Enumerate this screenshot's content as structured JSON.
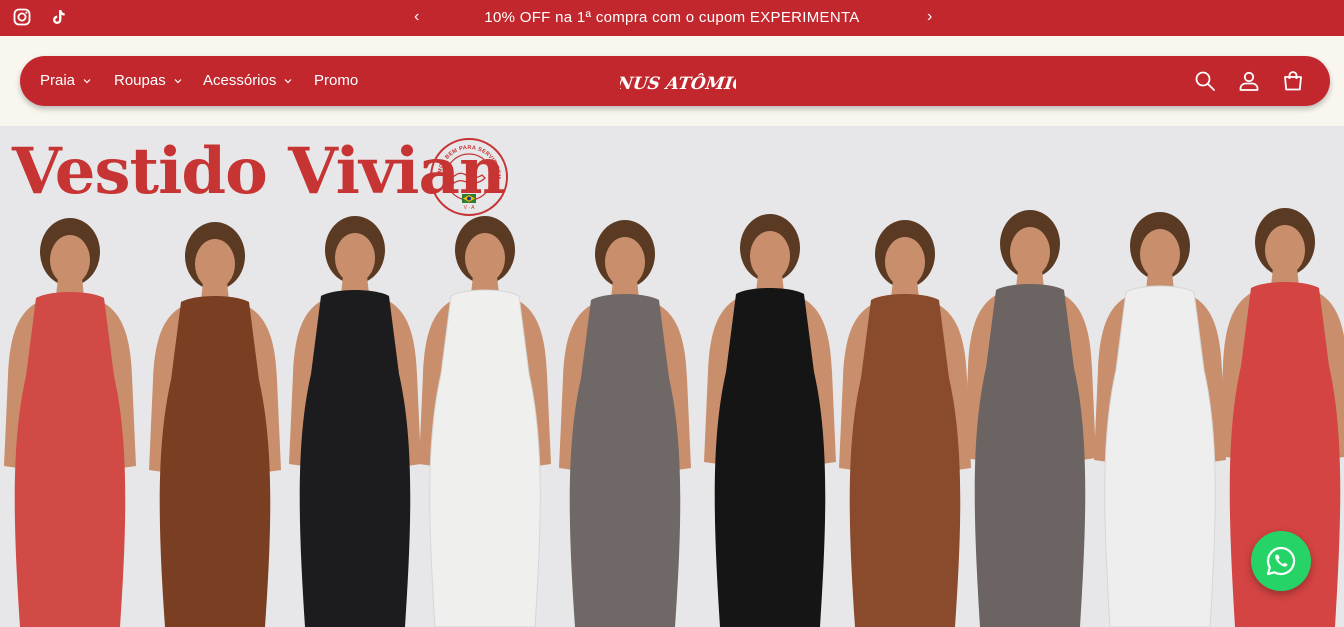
{
  "announcement": {
    "message": "10% OFF na 1ª compra com o cupom EXPERIMENTA",
    "prev_label": "‹",
    "next_label": "›"
  },
  "social": [
    {
      "icon": "instagram-icon"
    },
    {
      "icon": "tiktok-icon"
    }
  ],
  "nav": {
    "items": [
      {
        "label": "Praia",
        "has_dropdown": true
      },
      {
        "label": "Roupas",
        "has_dropdown": true
      },
      {
        "label": "Acessórios",
        "has_dropdown": true
      },
      {
        "label": "Promo",
        "has_dropdown": false
      }
    ],
    "logo_text": "VÊNUS ATÔMICA",
    "icons": [
      "search-icon",
      "account-icon",
      "cart-icon"
    ]
  },
  "hero": {
    "title": "Vestido Vivian",
    "badge_text": "SERVIMOS BEM PARA SERVIR SEMPRE",
    "badge_letters": "V · A",
    "dress_colors": [
      "#d24a45",
      "#7a3f22",
      "#1c1c1e",
      "#efefee",
      "#6f6866",
      "#151515",
      "#8a4a2c",
      "#6b6462",
      "#eeeeee",
      "#d34442"
    ]
  },
  "colors": {
    "brand_red": "#c1272d",
    "title_red": "#c63433",
    "whatsapp_green": "#25d366"
  }
}
